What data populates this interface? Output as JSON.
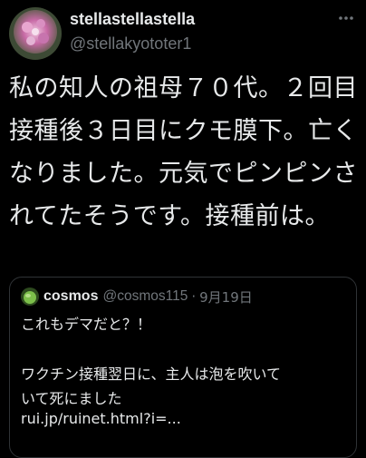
{
  "tweet": {
    "display_name": "stellastellastella",
    "handle": "@stellakyototer1",
    "text": "私の知人の祖母７０代。２回目接種後３日目にクモ膜下。亡くなりました。元気でピンピンされてたそうです。接種前は。"
  },
  "quote": {
    "display_name": "cosmos",
    "handle": "@cosmos115",
    "separator": "·",
    "date": "9月19日",
    "line1": "これもデマだと？！",
    "line2": "ワクチン接種翌日に、主人は泡を吹いて",
    "line3": "いて死にました",
    "line4": "rui.jp/ruinet.html?i=..."
  },
  "icons": {
    "more": "more-options-icon"
  }
}
